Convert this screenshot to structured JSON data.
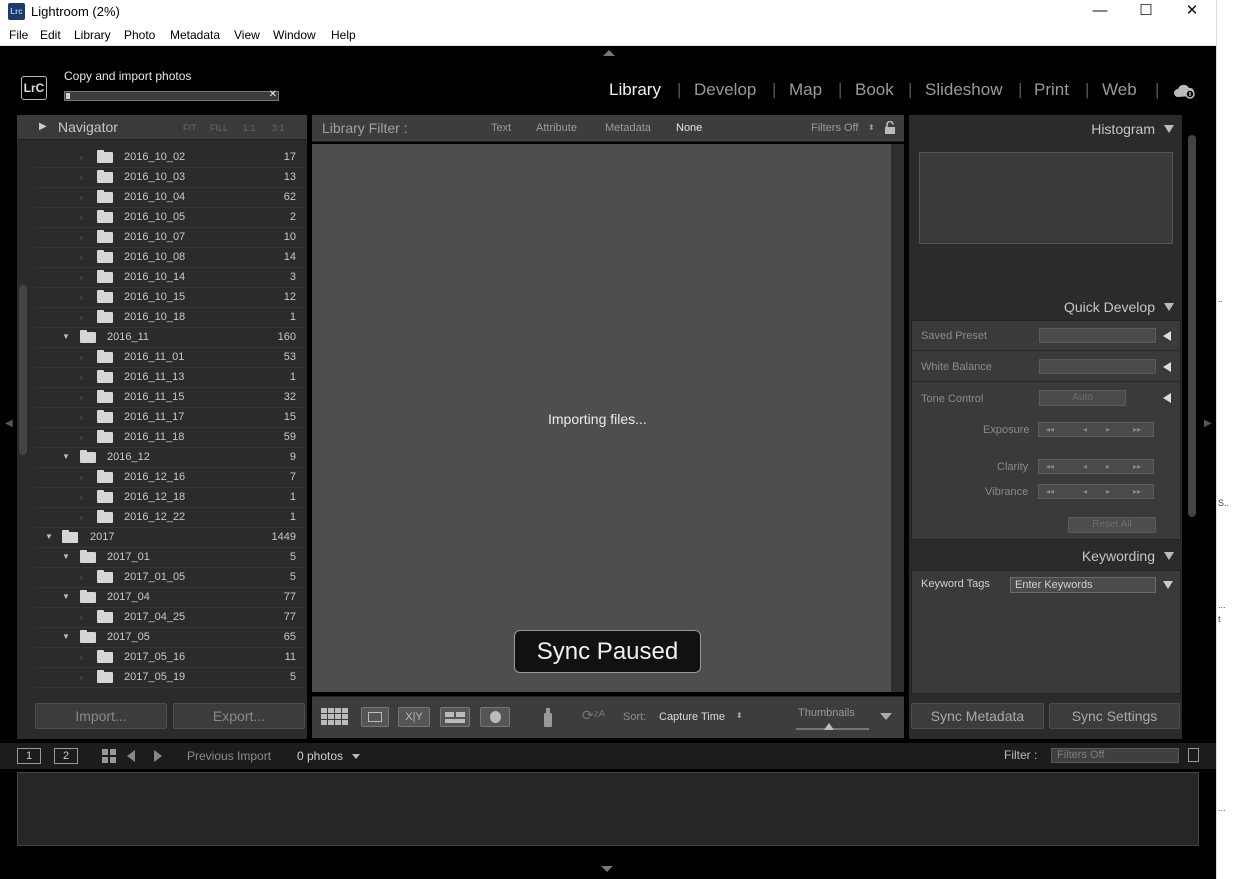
{
  "window": {
    "title": "Lightroom (2%)",
    "app_icon": "Lrc",
    "minimize": "—",
    "maximize": "☐",
    "close": "✕"
  },
  "menu": [
    "File",
    "Edit",
    "Library",
    "Photo",
    "Metadata",
    "View",
    "Window",
    "Help"
  ],
  "header": {
    "logo": "LrC",
    "import_status": "Copy and import photos",
    "import_progress": 0.02,
    "modules": [
      "Library",
      "Develop",
      "Map",
      "Book",
      "Slideshow",
      "Print",
      "Web"
    ],
    "active_module": "Library"
  },
  "left_panel": {
    "navigator_title": "Navigator",
    "zoom_options": [
      "FIT",
      "FILL",
      "1:1",
      "3:1"
    ],
    "folders": [
      {
        "name": "2016_10_02",
        "count": "17",
        "level": 2
      },
      {
        "name": "2016_10_03",
        "count": "13",
        "level": 2
      },
      {
        "name": "2016_10_04",
        "count": "62",
        "level": 2
      },
      {
        "name": "2016_10_05",
        "count": "2",
        "level": 2
      },
      {
        "name": "2016_10_07",
        "count": "10",
        "level": 2
      },
      {
        "name": "2016_10_08",
        "count": "14",
        "level": 2
      },
      {
        "name": "2016_10_14",
        "count": "3",
        "level": 2
      },
      {
        "name": "2016_10_15",
        "count": "12",
        "level": 2
      },
      {
        "name": "2016_10_18",
        "count": "1",
        "level": 2
      },
      {
        "name": "2016_11",
        "count": "160",
        "level": 1
      },
      {
        "name": "2016_11_01",
        "count": "53",
        "level": 2
      },
      {
        "name": "2016_11_13",
        "count": "1",
        "level": 2
      },
      {
        "name": "2016_11_15",
        "count": "32",
        "level": 2
      },
      {
        "name": "2016_11_17",
        "count": "15",
        "level": 2
      },
      {
        "name": "2016_11_18",
        "count": "59",
        "level": 2
      },
      {
        "name": "2016_12",
        "count": "9",
        "level": 1
      },
      {
        "name": "2016_12_16",
        "count": "7",
        "level": 2
      },
      {
        "name": "2016_12_18",
        "count": "1",
        "level": 2
      },
      {
        "name": "2016_12_22",
        "count": "1",
        "level": 2
      },
      {
        "name": "2017",
        "count": "1449",
        "level": 0
      },
      {
        "name": "2017_01",
        "count": "5",
        "level": 1
      },
      {
        "name": "2017_01_05",
        "count": "5",
        "level": 2
      },
      {
        "name": "2017_04",
        "count": "77",
        "level": 1
      },
      {
        "name": "2017_04_25",
        "count": "77",
        "level": 2
      },
      {
        "name": "2017_05",
        "count": "65",
        "level": 1
      },
      {
        "name": "2017_05_16",
        "count": "11",
        "level": 2
      },
      {
        "name": "2017_05_19",
        "count": "5",
        "level": 2
      }
    ],
    "import_button": "Import...",
    "export_button": "Export..."
  },
  "filter_bar": {
    "label": "Library Filter :",
    "options": [
      "Text",
      "Attribute",
      "Metadata",
      "None"
    ],
    "active": "None",
    "preset": "Filters Off"
  },
  "center": {
    "importing_text": "Importing files...",
    "sync_overlay": "Sync Paused"
  },
  "toolbar": {
    "sort_label": "Sort:",
    "sort_value": "Capture Time",
    "thumbnails_label": "Thumbnails",
    "thumbnail_size": 0.45
  },
  "right_panel": {
    "histogram_title": "Histogram",
    "quick_develop_title": "Quick Develop",
    "saved_preset_label": "Saved Preset",
    "white_balance_label": "White Balance",
    "tone_control_label": "Tone Control",
    "auto_button": "Auto",
    "exposure_label": "Exposure",
    "clarity_label": "Clarity",
    "vibrance_label": "Vibrance",
    "reset_all": "Reset All",
    "keywording_title": "Keywording",
    "keyword_tags_label": "Keyword Tags",
    "keyword_input": "Enter Keywords",
    "sync_metadata": "Sync Metadata",
    "sync_settings": "Sync Settings"
  },
  "filmstrip": {
    "monitor_1": "1",
    "monitor_2": "2",
    "source": "Previous Import",
    "photos": "0 photos",
    "filter_label": "Filter :",
    "filter_value": "Filters Off"
  },
  "outer_strip": [
    "..",
    "S..",
    "...",
    "t",
    "..."
  ]
}
